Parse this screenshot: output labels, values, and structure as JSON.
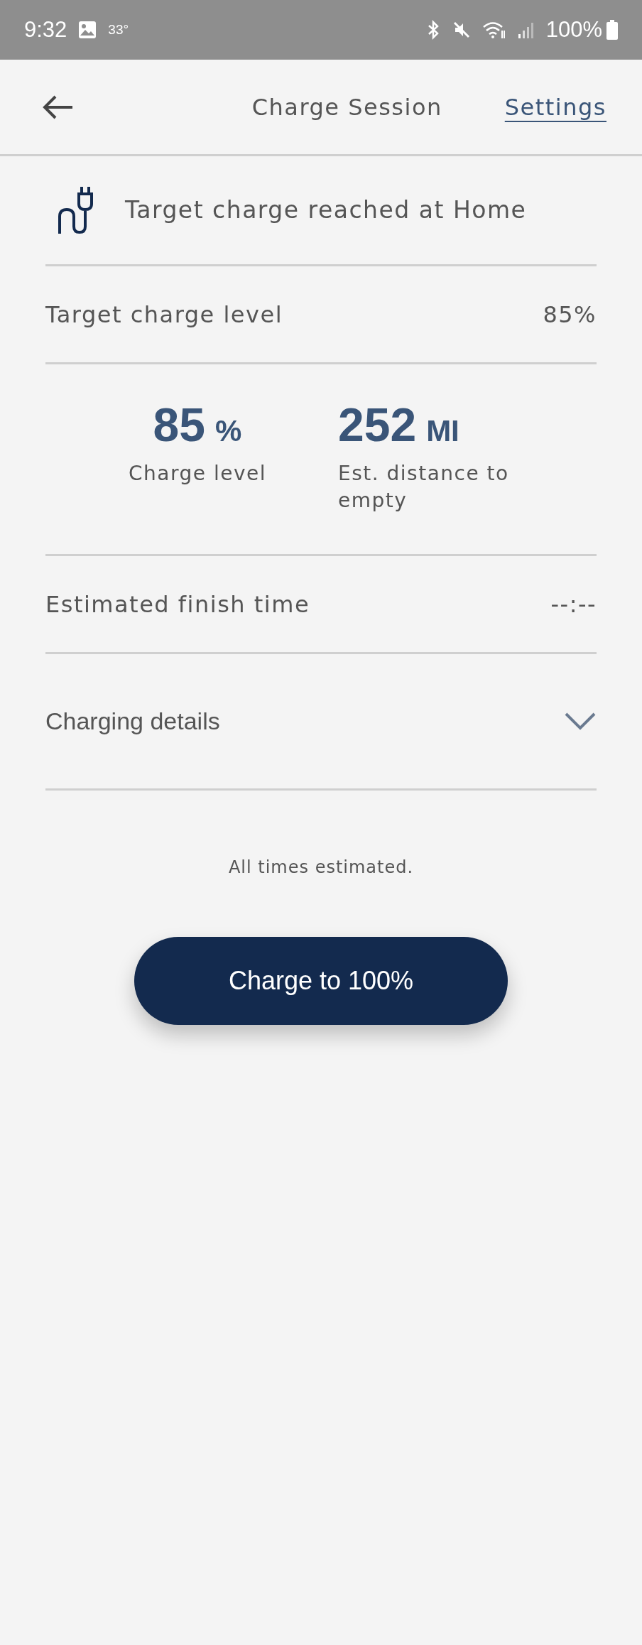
{
  "status_bar": {
    "time": "9:32",
    "temperature": "33°",
    "battery": "100%"
  },
  "header": {
    "title": "Charge Session",
    "action": "Settings"
  },
  "notice": {
    "text": "Target charge reached at Home"
  },
  "target": {
    "label": "Target charge level",
    "value": "85%"
  },
  "stats": [
    {
      "value": "85",
      "unit": "%",
      "label": "Charge level"
    },
    {
      "value": "252",
      "unit": "MI",
      "label": "Est. distance to empty"
    }
  ],
  "finish": {
    "label": "Estimated finish time",
    "value": "--:--"
  },
  "details": {
    "label": "Charging details",
    "expanded": false
  },
  "note": "All times estimated.",
  "button": "Charge to 100%"
}
